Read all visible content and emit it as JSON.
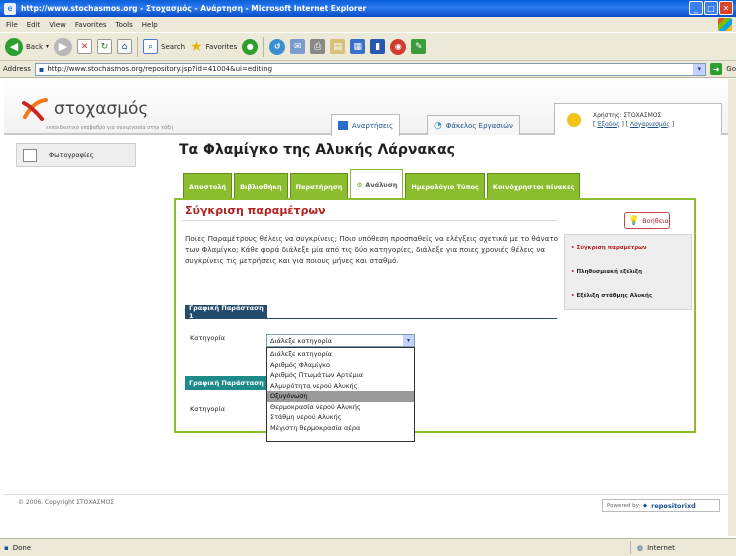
{
  "window": {
    "title": "http://www.stochasmos.org - Στοχασμός - Ανάρτηση - Microsoft Internet Explorer",
    "menu": [
      "File",
      "Edit",
      "View",
      "Favorites",
      "Tools",
      "Help"
    ],
    "toolbar": {
      "back": "Back",
      "search": "Search",
      "favorites": "Favorites"
    },
    "address_label": "Address",
    "address_url": "http://www.stochasmos.org/repository.jsp?id=41004&ui=editing",
    "go_label": "Go",
    "status_left": "Done",
    "status_right": "Internet"
  },
  "site": {
    "logo_name": "στοχασμός",
    "logo_tagline": "εκπαιδευτικό υπόβαθρο για συνεργασία στην τάξη",
    "header_tabs": [
      "Αναρτήσεις",
      "Φάκελος Εργασιών"
    ],
    "user": {
      "welcome": "Χρήστης: ΣΤΟΧΑΣΜΟΣ",
      "logout": "Έξοδος",
      "account": "Λογαριασμός"
    }
  },
  "sidebar": {
    "item": "Φωτογραφίες"
  },
  "main": {
    "title": "Τα Φλαμίγκο της Αλυκής Λάρνακας",
    "tabs": [
      "Αποστολή",
      "Βιβλιοθήκη",
      "Παρατήρηση",
      "Ανάλυση",
      "Ημερολόγιο Τύπος",
      "Κοινόχρηστοι πίνακες"
    ],
    "active_tab": "Ανάλυση",
    "section_title": "Σύγκριση παραμέτρων",
    "help_label": "Βοήθεια",
    "description": "Ποιες Παραμέτρους θέλεις να συγκρίνεις; Ποιο υπόθεση προσπαθείς να ελέγξεις σχετικά με το θάνατο των Φλαμίγκο; Κάθε φορά διάλεξε μία από τις δύο κατηγορίες, διάλεξε για ποιες χρονιές θέλεις να συγκρίνεις τις μετρήσεις και για ποιους μήνες και σταθμό.",
    "right_links": [
      "Σύγκριση παραμέτρων",
      "Πληθυσμιακή εξέλιξη",
      "Εξέλιξη στάθμης Αλυκής"
    ],
    "series1_label": "Γραφική Παράσταση 1",
    "series2_label": "Γραφική Παράσταση 2",
    "category_label": "Κατηγορία",
    "select_value": "Διάλεξε κατηγορία",
    "options": [
      "Διάλεξε κατηγορία",
      "Αριθμός Φλαμίγκο",
      "Αριθμός Πτωμάτων Αρτέμια",
      "Αλμυρότητα νερού Αλυκής",
      "Οξυγόνωση",
      "Θερμοκρασία νερού Αλυκής",
      "Στάθμη νερού Αλυκής",
      "Μέγιστη θερμοκρασία αέρα"
    ],
    "selected_option": "Οξυγόνωση"
  },
  "footer": {
    "copyright": "© 2006. Copyright ΣΤΟΧΑΣΜΟΣ",
    "powered_label": "Powered by",
    "powered_brand": "repositorixd"
  },
  "colors": {
    "accent_green": "#8bbd2e",
    "title_red": "#b22222",
    "navy": "#244a6e",
    "teal": "#1f8a8a"
  }
}
